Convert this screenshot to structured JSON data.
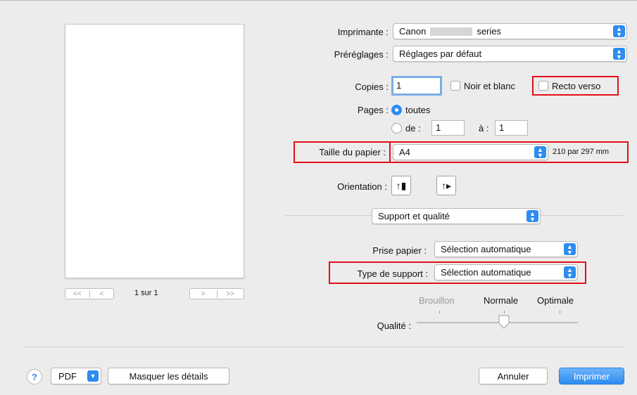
{
  "printer": {
    "label": "Imprimante :",
    "value_prefix": "Canon",
    "value_suffix": "series"
  },
  "presets": {
    "label": "Préréglages :",
    "value": "Réglages par défaut"
  },
  "copies": {
    "label": "Copies :",
    "value": "1"
  },
  "bw": {
    "label": "Noir et blanc"
  },
  "duplex": {
    "label": "Recto verso"
  },
  "pages": {
    "label": "Pages :",
    "all_label": "toutes",
    "from_label": "de :",
    "from_value": "1",
    "to_label": "à :",
    "to_value": "1"
  },
  "paper_size": {
    "label": "Taille du papier :",
    "value": "A4",
    "dimensions": "210 par 297 mm"
  },
  "orientation": {
    "label": "Orientation :",
    "portrait_icon": "portrait-icon",
    "landscape_icon": "landscape-icon"
  },
  "section": {
    "value": "Support et qualité"
  },
  "paper_source": {
    "label": "Prise papier :",
    "value": "Sélection automatique"
  },
  "media_type": {
    "label": "Type de support :",
    "value": "Sélection automatique"
  },
  "quality": {
    "label": "Qualité :",
    "draft": "Brouillon",
    "normal": "Normale",
    "high": "Optimale",
    "level": "Normale"
  },
  "preview_nav": {
    "page_text": "1 sur 1",
    "first": "<<",
    "prev": "<",
    "next": ">",
    "last": ">>"
  },
  "bottom": {
    "help": "?",
    "pdf": "PDF",
    "hide_details": "Masquer les détails",
    "cancel": "Annuler",
    "print": "Imprimer"
  },
  "colors": {
    "accent": "#2d8cf0",
    "highlight": "#e0101a"
  }
}
